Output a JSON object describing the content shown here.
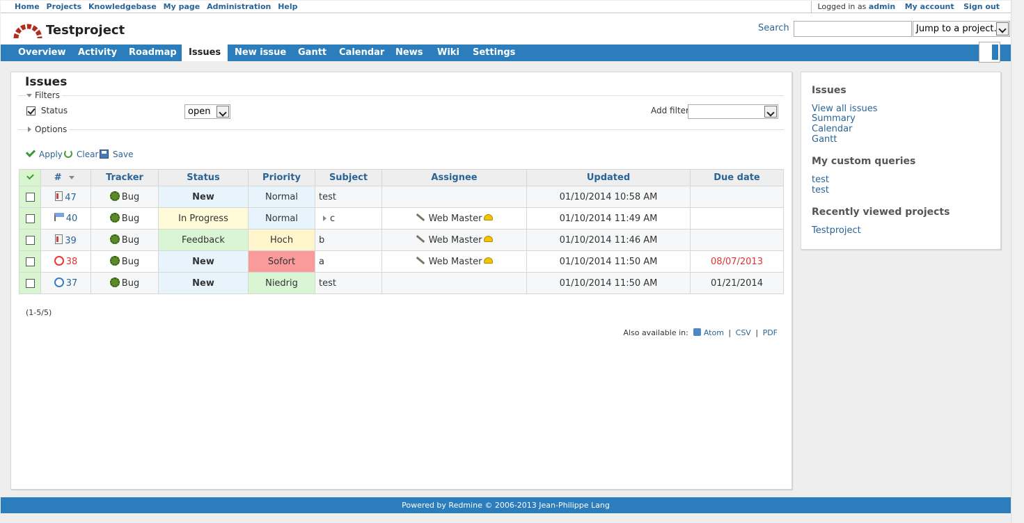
{
  "top_menu": {
    "links": [
      "Home",
      "Projects",
      "Knowledgebase",
      "My page",
      "Administration",
      "Help"
    ],
    "logged_in_label": "Logged in as",
    "user": "admin",
    "my_account": "My account",
    "sign_out": "Sign out"
  },
  "header": {
    "project_title": "Testproject",
    "search_label": "Search",
    "search_value": "",
    "jump_label": "Jump to a project..."
  },
  "main_menu": {
    "tabs": [
      "Overview",
      "Activity",
      "Roadmap",
      "Issues",
      "New issue",
      "Gantt",
      "Calendar",
      "News",
      "Wiki",
      "Settings"
    ],
    "active": "Issues"
  },
  "content": {
    "title": "Issues",
    "filters_legend": "Filters",
    "status_filter_label": "Status",
    "status_filter_value": "open",
    "add_filter_label": "Add filter",
    "add_filter_value": "",
    "options_legend": "Options",
    "apply": "Apply",
    "clear": "Clear",
    "save": "Save",
    "pagination": "(1-5/5)",
    "also_available": "Also available in:",
    "formats": [
      "Atom",
      "CSV",
      "PDF"
    ],
    "separator": "|"
  },
  "table": {
    "headers": {
      "num": "#",
      "tracker": "Tracker",
      "status": "Status",
      "priority": "Priority",
      "subject": "Subject",
      "assignee": "Assignee",
      "updated": "Updated",
      "due": "Due date"
    },
    "rows": [
      {
        "id": "47",
        "tracker": "Bug",
        "status": "New",
        "priority": "Normal",
        "subject": "test",
        "assignee": "",
        "updated": "01/10/2014 10:58 AM",
        "due": ""
      },
      {
        "id": "40",
        "tracker": "Bug",
        "status": "In Progress",
        "priority": "Normal",
        "subject": "c",
        "assignee": "Web Master",
        "updated": "01/10/2014 11:49 AM",
        "due": ""
      },
      {
        "id": "39",
        "tracker": "Bug",
        "status": "Feedback",
        "priority": "Hoch",
        "subject": "b",
        "assignee": "Web Master",
        "updated": "01/10/2014 11:46 AM",
        "due": ""
      },
      {
        "id": "38",
        "tracker": "Bug",
        "status": "New",
        "priority": "Sofort",
        "subject": "a",
        "assignee": "Web Master",
        "updated": "01/10/2014 11:50 AM",
        "due": "08/07/2013"
      },
      {
        "id": "37",
        "tracker": "Bug",
        "status": "New",
        "priority": "Niedrig",
        "subject": "test",
        "assignee": "",
        "updated": "01/10/2014 11:50 AM",
        "due": "01/21/2014"
      }
    ]
  },
  "sidebar": {
    "issues_heading": "Issues",
    "issues_links": [
      "View all issues",
      "Summary",
      "Calendar",
      "Gantt"
    ],
    "queries_heading": "My custom queries",
    "queries": [
      "test",
      "test"
    ],
    "recent_heading": "Recently viewed projects",
    "recent": [
      "Testproject"
    ]
  },
  "footer": {
    "text": "Powered by Redmine © 2006-2013 Jean-Philippe Lang"
  },
  "colors": {
    "accent": "#2c7dbb",
    "link": "#2a6496",
    "overdue": "#dd3333"
  }
}
